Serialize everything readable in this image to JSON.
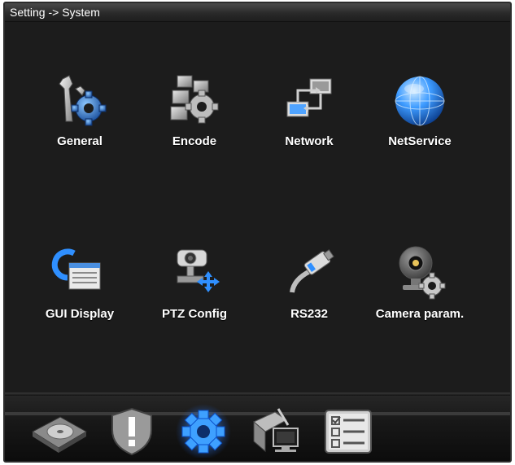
{
  "window": {
    "title": "Setting -> System"
  },
  "tiles": [
    {
      "label": "General",
      "icon": "wrench-gear-icon"
    },
    {
      "label": "Encode",
      "icon": "blocks-gear-icon"
    },
    {
      "label": "Network",
      "icon": "network-computers-icon"
    },
    {
      "label": "NetService",
      "icon": "globe-icon"
    },
    {
      "label": "GUI Display",
      "icon": "display-window-icon"
    },
    {
      "label": "PTZ Config",
      "icon": "ptz-camera-icon"
    },
    {
      "label": "RS232",
      "icon": "serial-cable-icon"
    },
    {
      "label": "Camera param.",
      "icon": "webcam-gear-icon"
    }
  ],
  "taskbar": {
    "items": [
      {
        "icon": "hard-disk-icon"
      },
      {
        "icon": "alarm-shield-icon"
      },
      {
        "icon": "system-gear-icon",
        "active": true
      },
      {
        "icon": "tools-monitor-icon"
      },
      {
        "icon": "info-checklist-icon"
      }
    ]
  },
  "colors": {
    "background": "#1c1c1c",
    "label": "#ffffff",
    "accent_blue": "#2f8fff"
  }
}
